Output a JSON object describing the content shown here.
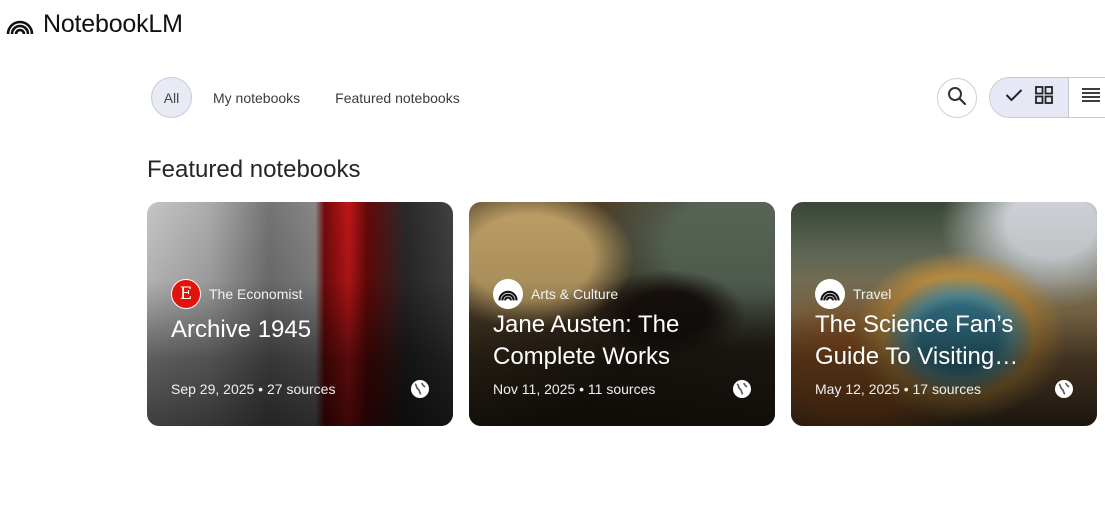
{
  "app": {
    "name": "NotebookLM"
  },
  "filters": [
    {
      "label": "All",
      "selected": true
    },
    {
      "label": "My notebooks",
      "selected": false
    },
    {
      "label": "Featured notebooks",
      "selected": false
    }
  ],
  "toolbar": {
    "search_icon": "search-icon",
    "view_mode": "grid"
  },
  "section": {
    "title": "Featured notebooks"
  },
  "cards": [
    {
      "source": "The Economist",
      "source_logo": "E",
      "title": "Archive 1945",
      "meta": "Sep 29, 2025 • 27 sources"
    },
    {
      "source": "Arts & Culture",
      "title": "Jane Austen: The Complete Works",
      "meta": "Nov 11, 2025 • 11 sources"
    },
    {
      "source": "Travel",
      "title": "The Science Fan’s Guide To Visiting…",
      "meta": "May 12, 2025 • 17 sources"
    }
  ],
  "colors": {
    "accent_chip": "#e8eaf4",
    "economist_red": "#e3120b"
  }
}
